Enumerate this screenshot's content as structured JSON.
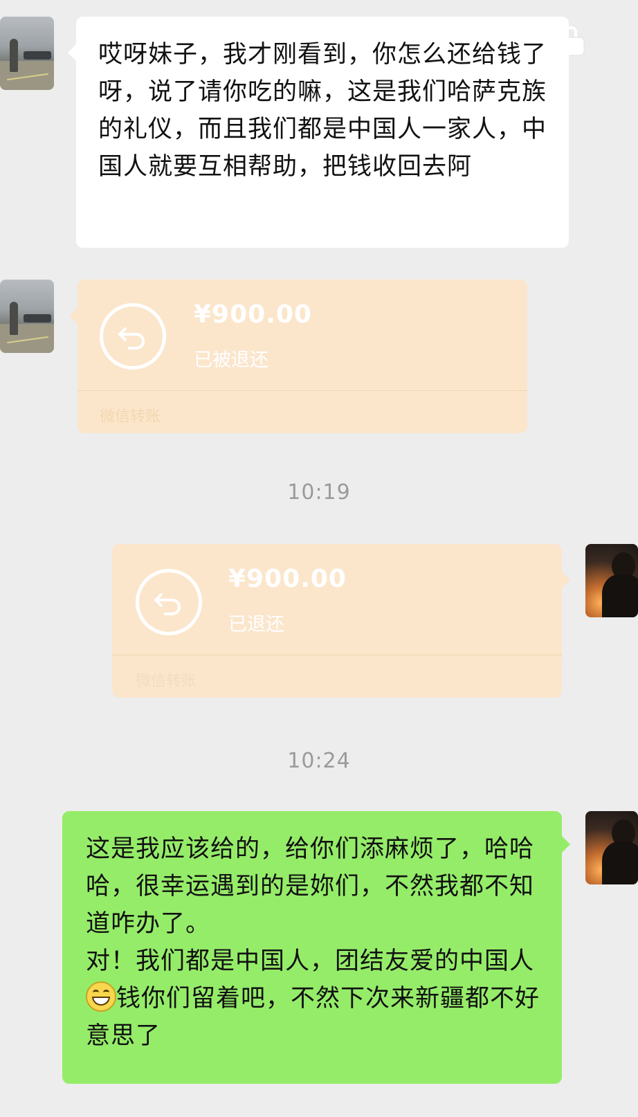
{
  "messages": {
    "m1_text": "哎呀妹子，我才刚看到，你怎么还给钱了呀，说了请你吃的嘛，这是我们哈萨克族的礼仪，而且我们都是中国人一家人，中国人就要互相帮助，把钱收回去阿",
    "transfer1": {
      "amount": "¥900.00",
      "status": "已被退还",
      "label": "微信转账"
    },
    "time1": "10:19",
    "transfer2": {
      "amount": "¥900.00",
      "status": "已退还",
      "label": "微信转账"
    },
    "time2": "10:24",
    "m4_before_emoji": "这是我应该给的，给你们添麻烦了，哈哈哈，很幸运遇到的是妳们，不然我都不知道咋办了。\n对！我们都是中国人，团结友爱的中国人",
    "m4_after_emoji": "钱你们留着吧，不然下次来新疆都不好意思了",
    "emoji_name": "grinning-face-icon"
  },
  "colors": {
    "background": "#ededed",
    "incoming_bubble": "#ffffff",
    "outgoing_bubble": "#95ec69",
    "transfer_card": "#fbe6cc",
    "timestamp": "#9a9a9a"
  }
}
